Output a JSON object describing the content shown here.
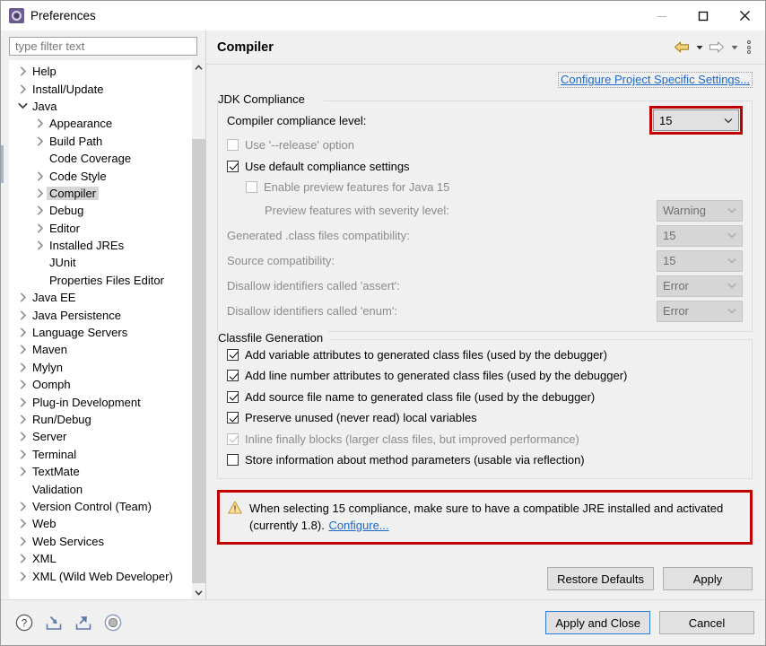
{
  "window": {
    "title": "Preferences",
    "icon": "preferences-gear-icon",
    "controls": {
      "minimize": "minimize-icon",
      "maximize": "maximize-icon",
      "close": "close-icon"
    }
  },
  "sidebar": {
    "filter": {
      "placeholder": "type filter text",
      "value": ""
    },
    "tree": [
      {
        "label": "Help",
        "depth": 1,
        "expandable": true,
        "expanded": false,
        "selected": false
      },
      {
        "label": "Install/Update",
        "depth": 1,
        "expandable": true,
        "expanded": false,
        "selected": false
      },
      {
        "label": "Java",
        "depth": 1,
        "expandable": true,
        "expanded": true,
        "selected": false
      },
      {
        "label": "Appearance",
        "depth": 2,
        "expandable": true,
        "expanded": false,
        "selected": false
      },
      {
        "label": "Build Path",
        "depth": 2,
        "expandable": true,
        "expanded": false,
        "selected": false
      },
      {
        "label": "Code Coverage",
        "depth": 2,
        "expandable": false,
        "expanded": false,
        "selected": false
      },
      {
        "label": "Code Style",
        "depth": 2,
        "expandable": true,
        "expanded": false,
        "selected": false
      },
      {
        "label": "Compiler",
        "depth": 2,
        "expandable": true,
        "expanded": false,
        "selected": true
      },
      {
        "label": "Debug",
        "depth": 2,
        "expandable": true,
        "expanded": false,
        "selected": false
      },
      {
        "label": "Editor",
        "depth": 2,
        "expandable": true,
        "expanded": false,
        "selected": false
      },
      {
        "label": "Installed JREs",
        "depth": 2,
        "expandable": true,
        "expanded": false,
        "selected": false
      },
      {
        "label": "JUnit",
        "depth": 2,
        "expandable": false,
        "expanded": false,
        "selected": false
      },
      {
        "label": "Properties Files Editor",
        "depth": 2,
        "expandable": false,
        "expanded": false,
        "selected": false
      },
      {
        "label": "Java EE",
        "depth": 1,
        "expandable": true,
        "expanded": false,
        "selected": false
      },
      {
        "label": "Java Persistence",
        "depth": 1,
        "expandable": true,
        "expanded": false,
        "selected": false
      },
      {
        "label": "Language Servers",
        "depth": 1,
        "expandable": true,
        "expanded": false,
        "selected": false
      },
      {
        "label": "Maven",
        "depth": 1,
        "expandable": true,
        "expanded": false,
        "selected": false
      },
      {
        "label": "Mylyn",
        "depth": 1,
        "expandable": true,
        "expanded": false,
        "selected": false
      },
      {
        "label": "Oomph",
        "depth": 1,
        "expandable": true,
        "expanded": false,
        "selected": false
      },
      {
        "label": "Plug-in Development",
        "depth": 1,
        "expandable": true,
        "expanded": false,
        "selected": false
      },
      {
        "label": "Run/Debug",
        "depth": 1,
        "expandable": true,
        "expanded": false,
        "selected": false
      },
      {
        "label": "Server",
        "depth": 1,
        "expandable": true,
        "expanded": false,
        "selected": false
      },
      {
        "label": "Terminal",
        "depth": 1,
        "expandable": true,
        "expanded": false,
        "selected": false
      },
      {
        "label": "TextMate",
        "depth": 1,
        "expandable": true,
        "expanded": false,
        "selected": false
      },
      {
        "label": "Validation",
        "depth": 1,
        "expandable": false,
        "expanded": false,
        "selected": false
      },
      {
        "label": "Version Control (Team)",
        "depth": 1,
        "expandable": true,
        "expanded": false,
        "selected": false
      },
      {
        "label": "Web",
        "depth": 1,
        "expandable": true,
        "expanded": false,
        "selected": false
      },
      {
        "label": "Web Services",
        "depth": 1,
        "expandable": true,
        "expanded": false,
        "selected": false
      },
      {
        "label": "XML",
        "depth": 1,
        "expandable": true,
        "expanded": false,
        "selected": false
      },
      {
        "label": "XML (Wild Web Developer)",
        "depth": 1,
        "expandable": true,
        "expanded": false,
        "selected": false
      }
    ]
  },
  "page": {
    "title": "Compiler",
    "nav": {
      "back": "back-arrow-icon",
      "back_menu": "back-dropdown-icon",
      "forward": "forward-arrow-icon",
      "forward_menu": "forward-dropdown-icon",
      "menu": "view-menu-icon"
    },
    "project_specific_link": "Configure Project Specific Settings...",
    "jdk_compliance": {
      "title": "JDK Compliance",
      "compliance_level_label": "Compiler compliance level:",
      "compliance_level_value": "15",
      "release_option_label": "Use '--release' option",
      "default_compliance_label": "Use default compliance settings",
      "preview_features_label": "Enable preview features for Java 15",
      "preview_severity_label": "Preview features with severity level:",
      "preview_severity_value": "Warning",
      "classfiles_label": "Generated .class files compatibility:",
      "classfiles_value": "15",
      "source_label": "Source compatibility:",
      "source_value": "15",
      "assert_label": "Disallow identifiers called 'assert':",
      "assert_value": "Error",
      "enum_label": "Disallow identifiers called 'enum':",
      "enum_value": "Error"
    },
    "classfile_generation": {
      "title": "Classfile Generation",
      "items": [
        "Add variable attributes to generated class files (used by the debugger)",
        "Add line number attributes to generated class files (used by the debugger)",
        "Add source file name to generated class file (used by the debugger)",
        "Preserve unused (never read) local variables",
        "Inline finally blocks (larger class files, but improved performance)",
        "Store information about method parameters (usable via reflection)"
      ]
    },
    "warning": {
      "icon": "warning-triangle-icon",
      "text": "When selecting 15 compliance, make sure to have a compatible JRE installed and activated (currently 1.8).",
      "link": "Configure..."
    },
    "restore_defaults_label": "Restore Defaults",
    "apply_label": "Apply"
  },
  "footer": {
    "help_icon": "help-question-icon",
    "import_icon": "import-icon",
    "export_icon": "export-icon",
    "record_icon": "record-circle-icon",
    "apply_and_close_label": "Apply and Close",
    "cancel_label": "Cancel"
  },
  "colors": {
    "highlight_red": "#c00000",
    "link_blue": "#1d69c9",
    "warning_amber": "#f0c060",
    "nav_back_gold": "#e8b33c"
  }
}
